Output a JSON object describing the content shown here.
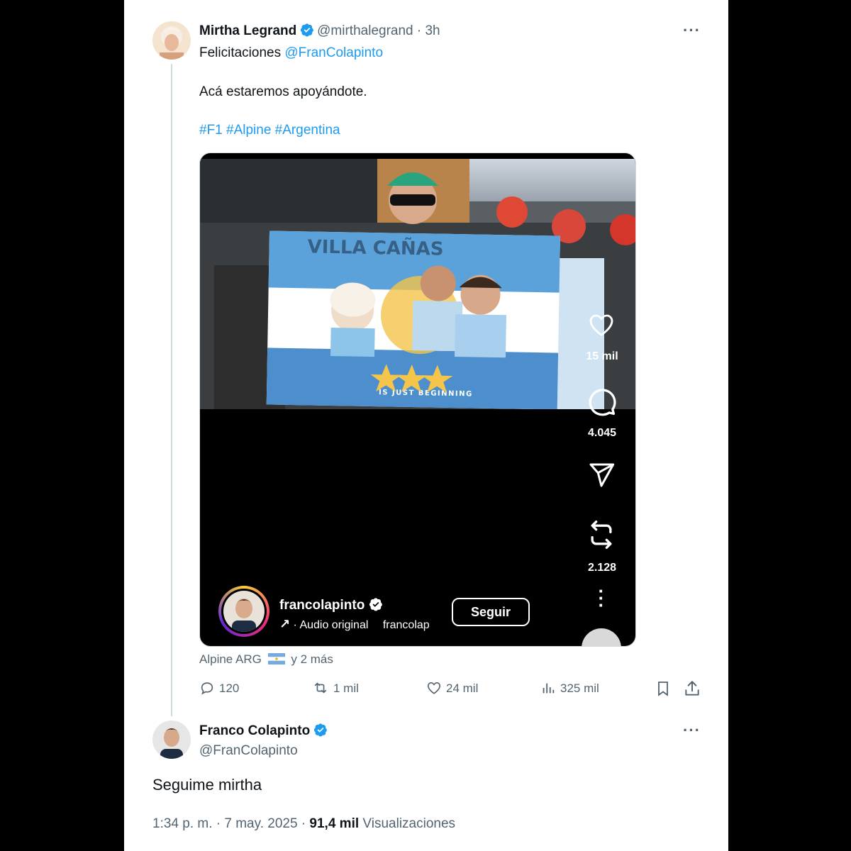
{
  "tweet1": {
    "author_name": "Mirtha Legrand",
    "handle_time": "@mirthalegrand · 3h",
    "line1_prefix": "Felicitaciones ",
    "line1_mention": "@FranColapinto",
    "line2": "Acá estaremos apoyándote.",
    "hashtags": "#F1 #Alpine #Argentina",
    "tagged": "Alpine ARG",
    "tagged_more": "y 2 más",
    "stats": {
      "replies": "120",
      "reposts": "1 mil",
      "likes": "24 mil",
      "views": "325 mil"
    }
  },
  "embed": {
    "flag_text_top": "VILLA CAÑAS",
    "flag_text_bottom": "IS JUST BEGINNING",
    "likes": "15 mil",
    "comments": "4.045",
    "reposts": "2.128",
    "username": "francolapinto",
    "audio": "Audio original",
    "audio_user": "francolap",
    "follow_label": "Seguir"
  },
  "tweet2": {
    "author_name": "Franco Colapinto",
    "handle": "@FranColapinto",
    "text": "Seguime mirtha",
    "time_date": "1:34 p. m. · 7 may. 2025 · ",
    "views_count": "91,4 mil",
    "views_label": " Visualizaciones"
  },
  "colors": {
    "accent": "#1d9bf0",
    "secondary_text": "#536471",
    "background": "#ffffff",
    "frame": "#000000"
  },
  "icons": [
    "verified-badge-icon",
    "more-icon",
    "reply-icon",
    "repost-icon",
    "like-icon",
    "views-icon",
    "bookmark-icon",
    "share-icon",
    "heart-icon",
    "comment-icon",
    "send-icon",
    "flag-argentina-icon"
  ]
}
